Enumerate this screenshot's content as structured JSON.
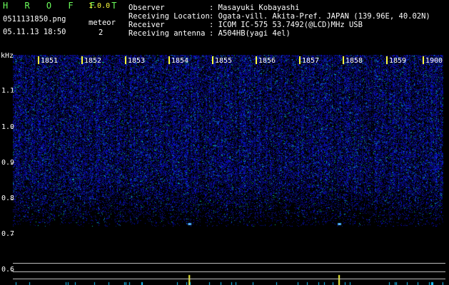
{
  "header": {
    "app_title": "H R O F F T",
    "version": "1.0.0",
    "file_name": "0511131850.png",
    "meteor_label": "meteor",
    "datetime": "05.11.13 18:50",
    "meteor_count": "2"
  },
  "info": [
    {
      "label": "Observer",
      "value": ": Masayuki Kobayashi"
    },
    {
      "label": "Receiving Location",
      "value": ": Ogata-vill. Akita-Pref. JAPAN (139.96E, 40.02N)"
    },
    {
      "label": "Receiver",
      "value": ": ICOM IC-575 53.7492(@LCD)MHz USB"
    },
    {
      "label": "Receiving antenna",
      "value": ": A504HB(yagi 4el)"
    }
  ],
  "spectrogram": {
    "y_unit": "kHz",
    "y_ticks": [
      "1.1",
      "1.0",
      "0.9",
      "0.8",
      "0.7",
      "0.6"
    ],
    "time_labels": [
      "1851",
      "1852",
      "1853",
      "1854",
      "1855",
      "1856",
      "1857",
      "1858",
      "1859",
      "1900"
    ],
    "background_color": "#000000",
    "signal_color": "#1d2cff",
    "marker_color": "#ffff3c",
    "detections": [
      {
        "time_fraction": 0.41,
        "freq_khz": 0.73
      },
      {
        "time_fraction": 0.758,
        "freq_khz": 0.73
      }
    ]
  }
}
